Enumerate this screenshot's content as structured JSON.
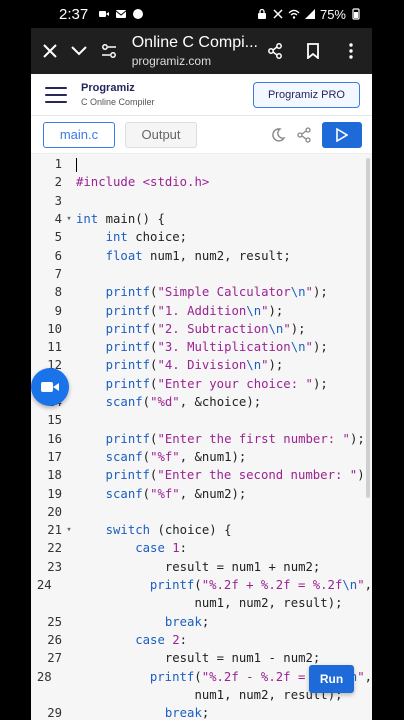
{
  "status_bar": {
    "time": "2:37",
    "battery": "75%"
  },
  "browser": {
    "title": "Online C Compi...",
    "url": "programiz.com"
  },
  "site": {
    "logo": "Programiz",
    "subtitle": "C Online Compiler",
    "pro_button": "Programiz PRO"
  },
  "editor": {
    "tabs": [
      "main.c",
      "Output"
    ],
    "run_label": "Run"
  },
  "code_lines": [
    {
      "n": "1",
      "fold": "",
      "html": ""
    },
    {
      "n": "2",
      "fold": "",
      "html": "<span class='inc'>#include</span> <span class='s'>&lt;stdio.h&gt;</span>"
    },
    {
      "n": "3",
      "fold": "",
      "html": ""
    },
    {
      "n": "4",
      "fold": "▾",
      "html": "<span class='k'>int</span> main() {"
    },
    {
      "n": "5",
      "fold": "",
      "html": "    <span class='k'>int</span> choice;"
    },
    {
      "n": "6",
      "fold": "",
      "html": "    <span class='k'>float</span> num1, num2, result;"
    },
    {
      "n": "7",
      "fold": "",
      "html": ""
    },
    {
      "n": "8",
      "fold": "",
      "html": "    <span class='k'>printf</span>(<span class='s'>\"Simple Calculator</span><span class='k'>\\n</span><span class='s'>\"</span>);"
    },
    {
      "n": "9",
      "fold": "",
      "html": "    <span class='k'>printf</span>(<span class='s'>\"1. Addition</span><span class='k'>\\n</span><span class='s'>\"</span>);"
    },
    {
      "n": "10",
      "fold": "",
      "html": "    <span class='k'>printf</span>(<span class='s'>\"2. Subtraction</span><span class='k'>\\n</span><span class='s'>\"</span>);"
    },
    {
      "n": "11",
      "fold": "",
      "html": "    <span class='k'>printf</span>(<span class='s'>\"3. Multiplication</span><span class='k'>\\n</span><span class='s'>\"</span>);"
    },
    {
      "n": "12",
      "fold": "",
      "html": "    <span class='k'>printf</span>(<span class='s'>\"4. Division</span><span class='k'>\\n</span><span class='s'>\"</span>);"
    },
    {
      "n": "13",
      "fold": "",
      "html": "    <span class='k'>printf</span>(<span class='s'>\"Enter your choice: \"</span>);"
    },
    {
      "n": "14",
      "fold": "",
      "html": "    <span class='k'>scanf</span>(<span class='s'>\"%d\"</span>, &amp;choice);"
    },
    {
      "n": "15",
      "fold": "",
      "html": ""
    },
    {
      "n": "16",
      "fold": "",
      "html": "    <span class='k'>printf</span>(<span class='s'>\"Enter the first number: \"</span>);"
    },
    {
      "n": "17",
      "fold": "",
      "html": "    <span class='k'>scanf</span>(<span class='s'>\"%f\"</span>, &amp;num1);"
    },
    {
      "n": "18",
      "fold": "",
      "html": "    <span class='k'>printf</span>(<span class='s'>\"Enter the second number: \"</span>);"
    },
    {
      "n": "19",
      "fold": "",
      "html": "    <span class='k'>scanf</span>(<span class='s'>\"%f\"</span>, &amp;num2);"
    },
    {
      "n": "20",
      "fold": "",
      "html": ""
    },
    {
      "n": "21",
      "fold": "▾",
      "html": "    <span class='k'>switch</span> (choice) {"
    },
    {
      "n": "22",
      "fold": "",
      "html": "        <span class='k'>case</span> <span class='s'>1</span>:"
    },
    {
      "n": "23",
      "fold": "",
      "html": "            result = num1 + num2;"
    },
    {
      "n": "24",
      "fold": "",
      "html": "            <span class='k'>printf</span>(<span class='s'>\"%.2f + %.2f = %.2f</span><span class='k'>\\n</span><span class='s'>\"</span>,"
    },
    {
      "n": "",
      "fold": "",
      "html": "                num1, num2, result);"
    },
    {
      "n": "25",
      "fold": "",
      "html": "            <span class='k'>break</span>;"
    },
    {
      "n": "26",
      "fold": "",
      "html": "        <span class='k'>case</span> <span class='s'>2</span>:"
    },
    {
      "n": "27",
      "fold": "",
      "html": "            result = num1 - num2;"
    },
    {
      "n": "28",
      "fold": "",
      "html": "            <span class='k'>printf</span>(<span class='s'>\"%.2f - %.2f = %.2f</span><span class='k'>\\n</span><span class='s'>\"</span>,"
    },
    {
      "n": "",
      "fold": "",
      "html": "                num1, num2, result);"
    },
    {
      "n": "29",
      "fold": "",
      "html": "            <span class='k'>break</span>;"
    }
  ]
}
